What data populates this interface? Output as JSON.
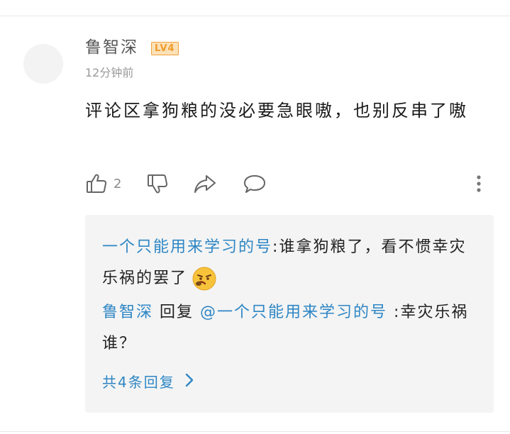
{
  "comment": {
    "username": "鲁智深",
    "level_badge": "LV4",
    "time": "12分钟前",
    "text": "评论区拿狗粮的没必要急眼嗷，也别反串了嗷",
    "like_count": "2"
  },
  "replies": [
    {
      "author": "一个只能用来学习的号",
      "separator": ":",
      "text": "谁拿狗粮了，看不惯幸灾乐祸的罢了",
      "emoji": "angry-face"
    },
    {
      "author": "鲁智深",
      "reply_word": " 回复 ",
      "mention": "@一个只能用来学习的号",
      "separator": " :",
      "text": "幸灾乐祸谁？"
    }
  ],
  "more_replies_label": "共4条回复",
  "colors": {
    "link_blue": "#2e86c4",
    "badge_orange": "#ef9c2b",
    "reply_bg": "#f4f4f4"
  },
  "icons": [
    "thumbs-up-icon",
    "thumbs-down-icon",
    "share-icon",
    "comment-icon",
    "more-vertical-icon",
    "chevron-right-icon"
  ]
}
